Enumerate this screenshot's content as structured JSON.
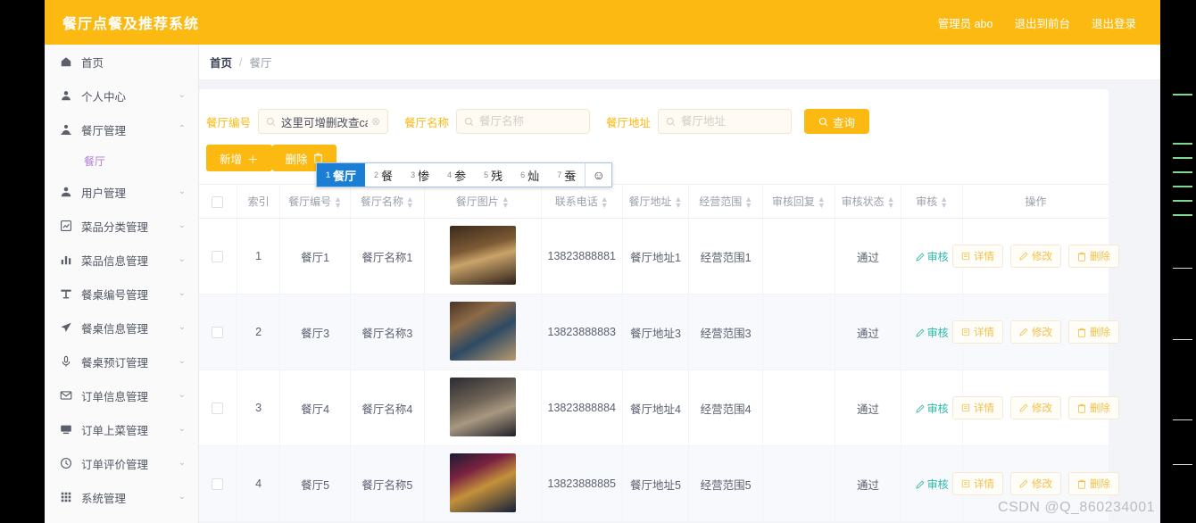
{
  "header": {
    "brand": "餐厅点餐及推荐系统",
    "admin_label": "管理员 abo",
    "exit_front": "退出到前台",
    "logout": "退出登录"
  },
  "sidebar": {
    "items": [
      {
        "label": "首页",
        "icon": "home-icon",
        "arrow": "",
        "expanded": false
      },
      {
        "label": "个人中心",
        "icon": "user-icon",
        "arrow": "⌄",
        "expanded": false
      },
      {
        "label": "餐厅管理",
        "icon": "user-tie-icon",
        "arrow": "⌃",
        "expanded": true
      },
      {
        "label": "用户管理",
        "icon": "people-icon",
        "arrow": "⌄",
        "expanded": false
      },
      {
        "label": "菜品分类管理",
        "icon": "chart-box-icon",
        "arrow": "⌄",
        "expanded": false
      },
      {
        "label": "菜品信息管理",
        "icon": "bar-chart-icon",
        "arrow": "⌄",
        "expanded": false
      },
      {
        "label": "餐桌编号管理",
        "icon": "table-icon",
        "arrow": "⌄",
        "expanded": false
      },
      {
        "label": "餐桌信息管理",
        "icon": "send-icon",
        "arrow": "⌄",
        "expanded": false
      },
      {
        "label": "餐桌预订管理",
        "icon": "mic-icon",
        "arrow": "⌄",
        "expanded": false
      },
      {
        "label": "订单信息管理",
        "icon": "mail-icon",
        "arrow": "⌄",
        "expanded": false
      },
      {
        "label": "订单上菜管理",
        "icon": "monitor-icon",
        "arrow": "⌄",
        "expanded": false
      },
      {
        "label": "订单评价管理",
        "icon": "clock-icon",
        "arrow": "⌄",
        "expanded": false
      },
      {
        "label": "系统管理",
        "icon": "grid-icon",
        "arrow": "⌄",
        "expanded": false
      }
    ],
    "submenu": {
      "label": "餐厅"
    }
  },
  "breadcrumb": {
    "home": "首页",
    "separator": "/",
    "current": "餐厅"
  },
  "filters": {
    "id": {
      "label": "餐厅编号",
      "value": "这里可增删改查can'ting",
      "placeholder": "餐厅编号"
    },
    "name": {
      "label": "餐厅名称",
      "value": "",
      "placeholder": "餐厅名称"
    },
    "address": {
      "label": "餐厅地址",
      "value": "",
      "placeholder": "餐厅地址"
    },
    "search_button": "查询"
  },
  "ime": {
    "candidates": [
      {
        "num": "1",
        "text": "餐厅",
        "active": true
      },
      {
        "num": "2",
        "text": "餐",
        "active": false
      },
      {
        "num": "3",
        "text": "惨",
        "active": false
      },
      {
        "num": "4",
        "text": "参",
        "active": false
      },
      {
        "num": "5",
        "text": "残",
        "active": false
      },
      {
        "num": "6",
        "text": "灿",
        "active": false
      },
      {
        "num": "7",
        "text": "蚕",
        "active": false
      }
    ],
    "emoji": "☺"
  },
  "actions": {
    "add": "新增",
    "add_glyph": "＋",
    "delete": "删除"
  },
  "table": {
    "columns": [
      {
        "label": "",
        "sortable": false,
        "key": "check"
      },
      {
        "label": "索引",
        "sortable": false,
        "key": "index"
      },
      {
        "label": "餐厅编号",
        "sortable": true,
        "key": "id"
      },
      {
        "label": "餐厅名称",
        "sortable": true,
        "key": "name"
      },
      {
        "label": "餐厅图片",
        "sortable": true,
        "key": "image"
      },
      {
        "label": "联系电话",
        "sortable": true,
        "key": "phone"
      },
      {
        "label": "餐厅地址",
        "sortable": true,
        "key": "address"
      },
      {
        "label": "经营范围",
        "sortable": true,
        "key": "scope"
      },
      {
        "label": "审核回复",
        "sortable": true,
        "key": "reply"
      },
      {
        "label": "审核状态",
        "sortable": true,
        "key": "status"
      },
      {
        "label": "审核",
        "sortable": true,
        "key": "audit"
      },
      {
        "label": "操作",
        "sortable": false,
        "key": "ops"
      }
    ],
    "rows": [
      {
        "index": "1",
        "id": "餐厅1",
        "name": "餐厅名称1",
        "phone": "13823888881",
        "address": "餐厅地址1",
        "scope": "经营范围1",
        "reply": "",
        "status": "通过",
        "audit": "审核"
      },
      {
        "index": "2",
        "id": "餐厅3",
        "name": "餐厅名称3",
        "phone": "13823888883",
        "address": "餐厅地址3",
        "scope": "经营范围3",
        "reply": "",
        "status": "通过",
        "audit": "审核"
      },
      {
        "index": "3",
        "id": "餐厅4",
        "name": "餐厅名称4",
        "phone": "13823888884",
        "address": "餐厅地址4",
        "scope": "经营范围4",
        "reply": "",
        "status": "通过",
        "audit": "审核"
      },
      {
        "index": "4",
        "id": "餐厅5",
        "name": "餐厅名称5",
        "phone": "13823888885",
        "address": "餐厅地址5",
        "scope": "经营范围5",
        "reply": "",
        "status": "通过",
        "audit": "审核"
      }
    ],
    "ops": {
      "detail": "详情",
      "edit": "修改",
      "remove": "删除"
    }
  },
  "watermark": "CSDN @Q_860234001",
  "colors": {
    "brand": "#fbb912",
    "audit_link": "#29b8a6",
    "submenu_active": "#b07cd8",
    "ime_active": "#1a7fd4"
  }
}
